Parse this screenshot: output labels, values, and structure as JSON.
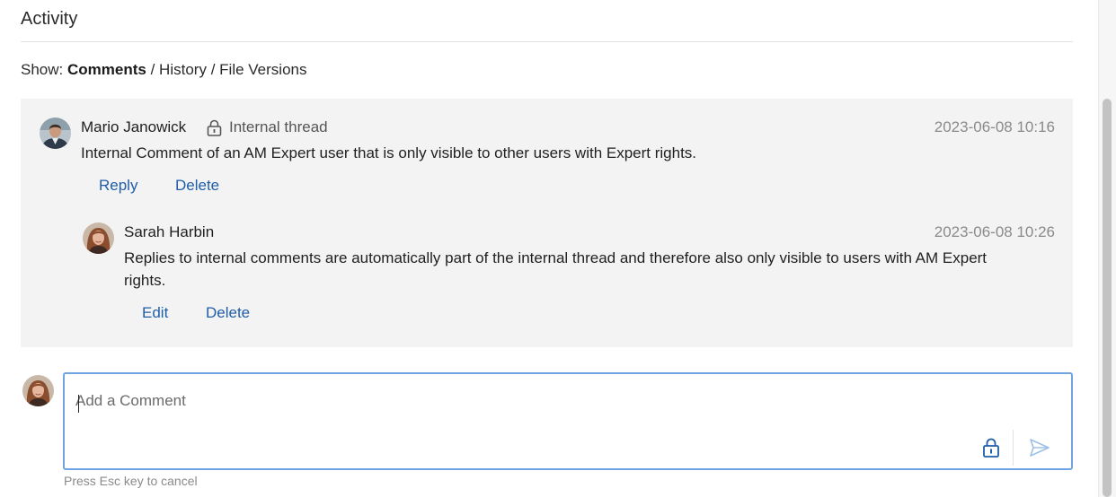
{
  "activity": {
    "title": "Activity"
  },
  "show": {
    "label": "Show:",
    "options": [
      "Comments",
      "History",
      "File Versions"
    ],
    "separator": "/"
  },
  "thread": {
    "root": {
      "author": "Mario Janowick",
      "tag": "Internal thread",
      "timestamp": "2023-06-08 10:16",
      "text": "Internal Comment of an AM Expert user that is only visible to other users with Expert rights.",
      "actions": [
        "Reply",
        "Delete"
      ],
      "avatar_icon": "user-avatar-male"
    },
    "reply": {
      "author": "Sarah Harbin",
      "timestamp": "2023-06-08 10:26",
      "text": "Replies to internal comments are automatically part of the internal thread and therefore also only visible to users with AM Expert rights.",
      "actions": [
        "Edit",
        "Delete"
      ],
      "avatar_icon": "user-avatar-female"
    }
  },
  "composer": {
    "placeholder": "Add a Comment",
    "value": "",
    "hint": "Press Esc key to cancel",
    "lock_icon": "lock-icon",
    "send_icon": "send-icon"
  },
  "colors": {
    "link": "#1f5ea8",
    "panel": "#f3f3f3",
    "focus_border": "#6fa3e3",
    "muted": "#8a8a8a"
  }
}
